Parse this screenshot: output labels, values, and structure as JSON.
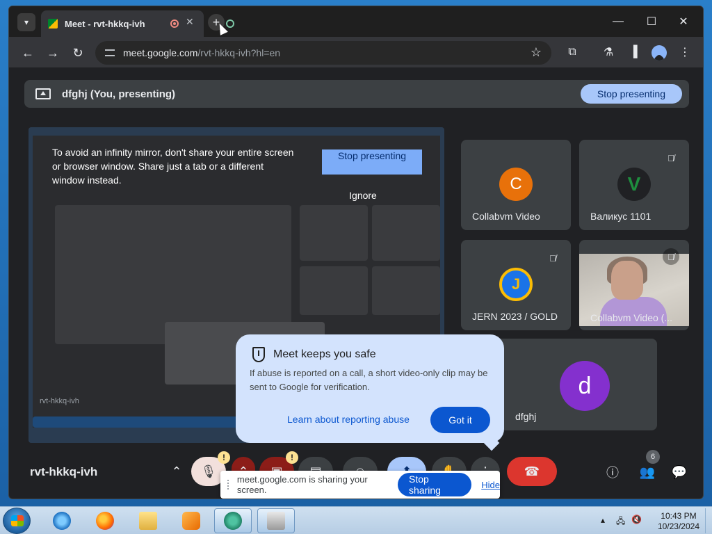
{
  "browser": {
    "tab_title": "Meet - rvt-hkkq-ivh",
    "url_host": "meet.google.com",
    "url_path": "/rvt-hkkq-ivh?hl=en"
  },
  "meet": {
    "presenter_label": "dfghj (You, presenting)",
    "stop_presenting_label": "Stop presenting",
    "mirror_warning": "To avoid an infinity mirror, don't share your entire screen or browser window. Share just a tab or a different window instead.",
    "mirror_stop_label": "Stop presenting",
    "mirror_ignore_label": "Ignore",
    "mirror_meeting_code": "rvt-hkkq-ivh",
    "participants": [
      {
        "name": "Collabvm Video",
        "initial": "C",
        "color": "#e8710a"
      },
      {
        "name": "Валикус 1101",
        "initial": "V",
        "color": "#202124"
      },
      {
        "name": "JERN 2023 / GOLD",
        "initial": "J",
        "color": "#1a73e8"
      },
      {
        "name": "Collabvm Video (...",
        "initial": "",
        "color": ""
      },
      {
        "name": "dfghj",
        "initial": "d",
        "color": "#8430ce"
      }
    ],
    "safety_popup": {
      "title": "Meet keeps you safe",
      "body": "If abuse is reported on a call, a short video-only clip may be sent to Google for verification.",
      "link": "Learn about reporting abuse",
      "button": "Got it"
    },
    "meeting_code": "rvt-hkkq-ivh",
    "people_count": "6",
    "share_notification": {
      "text": "meet.google.com is sharing your screen.",
      "stop_label": "Stop sharing",
      "hide_label": "Hide"
    }
  },
  "taskbar": {
    "time": "10:43 PM",
    "date": "10/23/2024"
  }
}
